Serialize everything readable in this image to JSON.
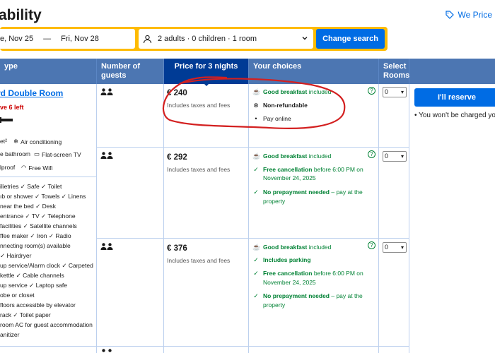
{
  "header": {
    "title": "ability",
    "price_match": "We Price"
  },
  "search": {
    "dates_from": "e, Nov 25",
    "dates_arrow": "—",
    "dates_to": "Fri, Nov 28",
    "guests": "2 adults · 0 children · 1 room",
    "change_label": "Change search"
  },
  "table": {
    "headers": {
      "room_type": "ype",
      "guests": "Number of guests",
      "price": "Price for 3 nights",
      "choices": "Your choices",
      "select": "Select Rooms"
    },
    "room": {
      "name": "rd Double Room",
      "scarcity": "ve 6 left",
      "facilities": [
        "et²",
        "Air conditioning",
        "e bathroom",
        "Flat-screen TV",
        "lproof",
        "Free Wifi"
      ],
      "amenities": [
        "ilietries ✓ Safe ✓ Toilet",
        "ıb or shower ✓ Towels ✓ Linens",
        "near the bed ✓ Desk",
        "entrance ✓ TV ✓ Telephone",
        "facilities ✓ Satellite channels",
        "ffee maker ✓ Iron ✓ Radio",
        "nnecting room(s) available",
        "✓ Hairdryer",
        "up service/Alarm clock ✓ Carpeted",
        "kettle ✓ Cable channels",
        "up service ✓ Laptop safe",
        "obe or closet",
        "floors accessible by elevator",
        "rack ✓ Toilet paper",
        "room AC for guest accommodation",
        "anitizer"
      ]
    },
    "options": [
      {
        "price": "€ 240",
        "price_note": "Includes taxes and fees",
        "choices": [
          {
            "bold": "Good breakfast",
            "rest": " included"
          },
          {
            "bold": "Non-refundable",
            "rest": ""
          },
          {
            "bold": "",
            "rest": "Pay online"
          }
        ],
        "select_value": "0"
      },
      {
        "price": "€ 292",
        "price_note": "Includes taxes and fees",
        "choices": [
          {
            "bold": "Good breakfast",
            "rest": " included"
          },
          {
            "bold": "Free cancellation",
            "rest": " before 6:00 PM on"
          },
          {
            "bold": "",
            "rest": "November 24, 2025"
          },
          {
            "bold": "No prepayment needed",
            "rest": " – pay at the"
          },
          {
            "bold": "",
            "rest": "property"
          }
        ],
        "select_value": "0"
      },
      {
        "price": "€ 376",
        "price_note": "Includes taxes and fees",
        "choices": [
          {
            "bold": "Good breakfast",
            "rest": " included"
          },
          {
            "bold": "Includes parking",
            "rest": ""
          },
          {
            "bold": "Free cancellation",
            "rest": " before 6:00 PM on"
          },
          {
            "bold": "",
            "rest": "November 24, 2025"
          },
          {
            "bold": "No prepayment needed",
            "rest": " – pay at the"
          },
          {
            "bold": "",
            "rest": "property"
          }
        ],
        "select_value": "0"
      }
    ],
    "help_glyph": "?"
  },
  "reserve": {
    "button_label": "I'll reserve",
    "note": "You won't be charged yo"
  },
  "colors": {
    "brand_blue": "#006ce4",
    "header_blue": "#4c76b2",
    "header_dark": "#003b95",
    "search_yellow": "#febb02",
    "green": "#008234",
    "annotation_red": "#d32020"
  }
}
